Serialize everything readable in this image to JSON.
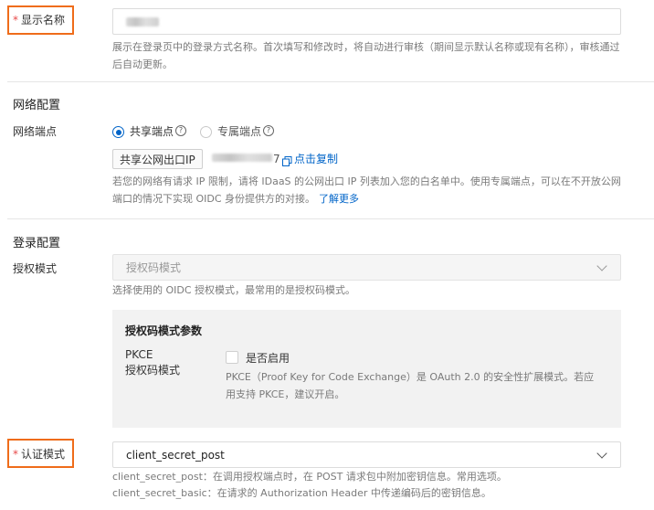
{
  "display_name": {
    "required_mark": "*",
    "label": "显示名称",
    "hint": "展示在登录页中的登录方式名称。首次填写和修改时，将自动进行审核（期间显示默认名称或现有名称），审核通过后自动更新。"
  },
  "network": {
    "section_title": "网络配置",
    "endpoint_label": "网络端点",
    "options": [
      "共享端点",
      "专属端点"
    ],
    "selected_option": "共享端点",
    "ip_button_label": "共享公网出口IP",
    "ip_suffix": "7",
    "copy_label": "点击复制",
    "hint_main": "若您的网络有请求 IP 限制，请将 IDaaS 的公网出口 IP 列表加入您的白名单中。使用专属端点，可以在不开放公网端口的情况下实现 OIDC 身份提供方的对接。",
    "learn_more": "了解更多"
  },
  "login": {
    "section_title": "登录配置",
    "grant_label": "授权模式",
    "grant_value": "授权码模式",
    "grant_hint": "选择使用的 OIDC 授权模式，最常用的是授权码模式。",
    "params": {
      "title": "授权码模式参数",
      "pkce_label": "PKCE",
      "pkce_sub": "授权码模式",
      "pkce_checkbox": "是否启用",
      "pkce_checked": false,
      "pkce_hint": "PKCE（Proof Key for Code Exchange）是 OAuth 2.0 的安全性扩展模式。若应用支持 PKCE，建议开启。"
    }
  },
  "auth": {
    "required_mark": "*",
    "label": "认证模式",
    "value": "client_secret_post",
    "hint_post": "client_secret_post：在调用授权端点时，在 POST 请求包中附加密钥信息。常用选项。",
    "hint_basic": "client_secret_basic：在请求的 Authorization Header 中传递编码后的密钥信息。"
  },
  "colors": {
    "highlight": "#ef6c1a",
    "primary": "#0064c8",
    "required": "#e84a4a",
    "panel_bg": "#f2f2f2"
  }
}
